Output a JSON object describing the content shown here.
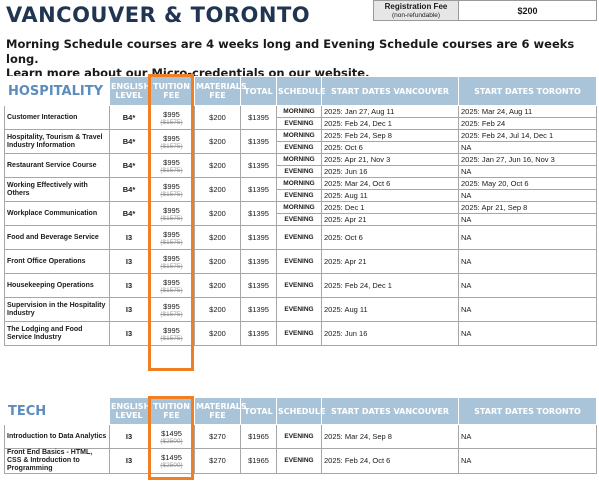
{
  "page_title": "VANCOUVER & TORONTO",
  "registration_fee": {
    "label": "Registration Fee",
    "note": "(non-refundable)",
    "value": "$200"
  },
  "intro": {
    "line1": "Morning Schedule courses are 4 weeks long and Evening Schedule courses are 6 weeks long.",
    "line2_prefix": "Learn more about our Micro-credentials on our ",
    "line2_link": "website",
    "line2_suffix": "."
  },
  "headers": {
    "english_level": "ENGLISH LEVEL",
    "tuition_fee": "TUITION FEE",
    "materials_fee": "MATERIALS FEE",
    "total": "TOTAL",
    "schedule": "SCHEDULE",
    "start_vancouver": "START DATES VANCOUVER",
    "start_toronto": "START DATES TORONTO"
  },
  "hospitality": {
    "section_title": "HOSPITALITY",
    "courses": [
      {
        "name": "Customer Interaction",
        "level": "B4*",
        "fee": "$995",
        "old_fee": "($1575)",
        "materials": "$200",
        "total": "$1395",
        "rows": [
          {
            "schedule": "MORNING",
            "vancouver": "2025: Jan 27, Aug 11",
            "toronto": "2025: Mar 24, Aug 11"
          },
          {
            "schedule": "EVENING",
            "vancouver": "2025: Feb 24, Dec 1",
            "toronto": "2025: Feb 24"
          }
        ]
      },
      {
        "name": "Hospitality, Tourism & Travel Industry Information",
        "level": "B4*",
        "fee": "$995",
        "old_fee": "($1575)",
        "materials": "$200",
        "total": "$1395",
        "rows": [
          {
            "schedule": "MORNING",
            "vancouver": "2025: Feb 24, Sep 8",
            "toronto": "2025: Feb 24, Jul 14, Dec 1"
          },
          {
            "schedule": "EVENING",
            "vancouver": "2025: Oct 6",
            "toronto": "NA"
          }
        ]
      },
      {
        "name": "Restaurant Service Course",
        "level": "B4*",
        "fee": "$995",
        "old_fee": "($1575)",
        "materials": "$200",
        "total": "$1395",
        "rows": [
          {
            "schedule": "MORNING",
            "vancouver": "2025: Apr 21, Nov 3",
            "toronto": "2025: Jan 27, Jun 16, Nov 3"
          },
          {
            "schedule": "EVENING",
            "vancouver": "2025: Jun 16",
            "toronto": "NA"
          }
        ]
      },
      {
        "name": "Working Effectively with Others",
        "level": "B4*",
        "fee": "$995",
        "old_fee": "($1575)",
        "materials": "$200",
        "total": "$1395",
        "rows": [
          {
            "schedule": "MORNING",
            "vancouver": "2025: Mar 24, Oct 6",
            "toronto": "2025: May 20, Oct 6"
          },
          {
            "schedule": "EVENING",
            "vancouver": "2025: Aug 11",
            "toronto": "NA"
          }
        ]
      },
      {
        "name": "Workplace Communication",
        "level": "B4*",
        "fee": "$995",
        "old_fee": "($1575)",
        "materials": "$200",
        "total": "$1395",
        "rows": [
          {
            "schedule": "MORNING",
            "vancouver": "2025: Dec 1",
            "toronto": "2025: Apr 21, Sep 8"
          },
          {
            "schedule": "EVENING",
            "vancouver": "2025: Apr 21",
            "toronto": "NA"
          }
        ]
      },
      {
        "name": "Food and Beverage Service",
        "level": "I3",
        "fee": "$995",
        "old_fee": "($1575)",
        "materials": "$200",
        "total": "$1395",
        "rows": [
          {
            "schedule": "EVENING",
            "vancouver": "2025: Oct 6",
            "toronto": "NA"
          }
        ]
      },
      {
        "name": "Front Office Operations",
        "level": "I3",
        "fee": "$995",
        "old_fee": "($1575)",
        "materials": "$200",
        "total": "$1395",
        "rows": [
          {
            "schedule": "EVENING",
            "vancouver": "2025: Apr 21",
            "toronto": "NA"
          }
        ]
      },
      {
        "name": "Housekeeping Operations",
        "level": "I3",
        "fee": "$995",
        "old_fee": "($1575)",
        "materials": "$200",
        "total": "$1395",
        "rows": [
          {
            "schedule": "EVENING",
            "vancouver": "2025: Feb 24, Dec 1",
            "toronto": "NA"
          }
        ]
      },
      {
        "name": "Supervision in the Hospitality Industry",
        "level": "I3",
        "fee": "$995",
        "old_fee": "($1575)",
        "materials": "$200",
        "total": "$1395",
        "rows": [
          {
            "schedule": "EVENING",
            "vancouver": "2025: Aug 11",
            "toronto": "NA"
          }
        ]
      },
      {
        "name": "The Lodging and Food Service Industry",
        "level": "I3",
        "fee": "$995",
        "old_fee": "($1575)",
        "materials": "$200",
        "total": "$1395",
        "rows": [
          {
            "schedule": "EVENING",
            "vancouver": "2025: Jun 16",
            "toronto": "NA"
          }
        ]
      }
    ]
  },
  "tech": {
    "section_title": "TECH",
    "courses": [
      {
        "name": "Introduction to Data Analytics",
        "level": "I3",
        "fee": "$1495",
        "old_fee": "($2500)",
        "materials": "$270",
        "total": "$1965",
        "rows": [
          {
            "schedule": "EVENING",
            "vancouver": "2025: Mar 24, Sep 8",
            "toronto": "NA"
          }
        ]
      },
      {
        "name": "Front End Basics - HTML, CSS & Introduction to Programming",
        "level": "I3",
        "fee": "$1495",
        "old_fee": "($2500)",
        "materials": "$270",
        "total": "$1965",
        "rows": [
          {
            "schedule": "EVENING",
            "vancouver": "2025: Feb 24, Oct 6",
            "toronto": "NA"
          }
        ]
      }
    ]
  },
  "colors": {
    "title": "#1f3550",
    "section": "#5b8cbc",
    "header_bg": "#a9c4d9",
    "highlight": "#ef7f22"
  }
}
